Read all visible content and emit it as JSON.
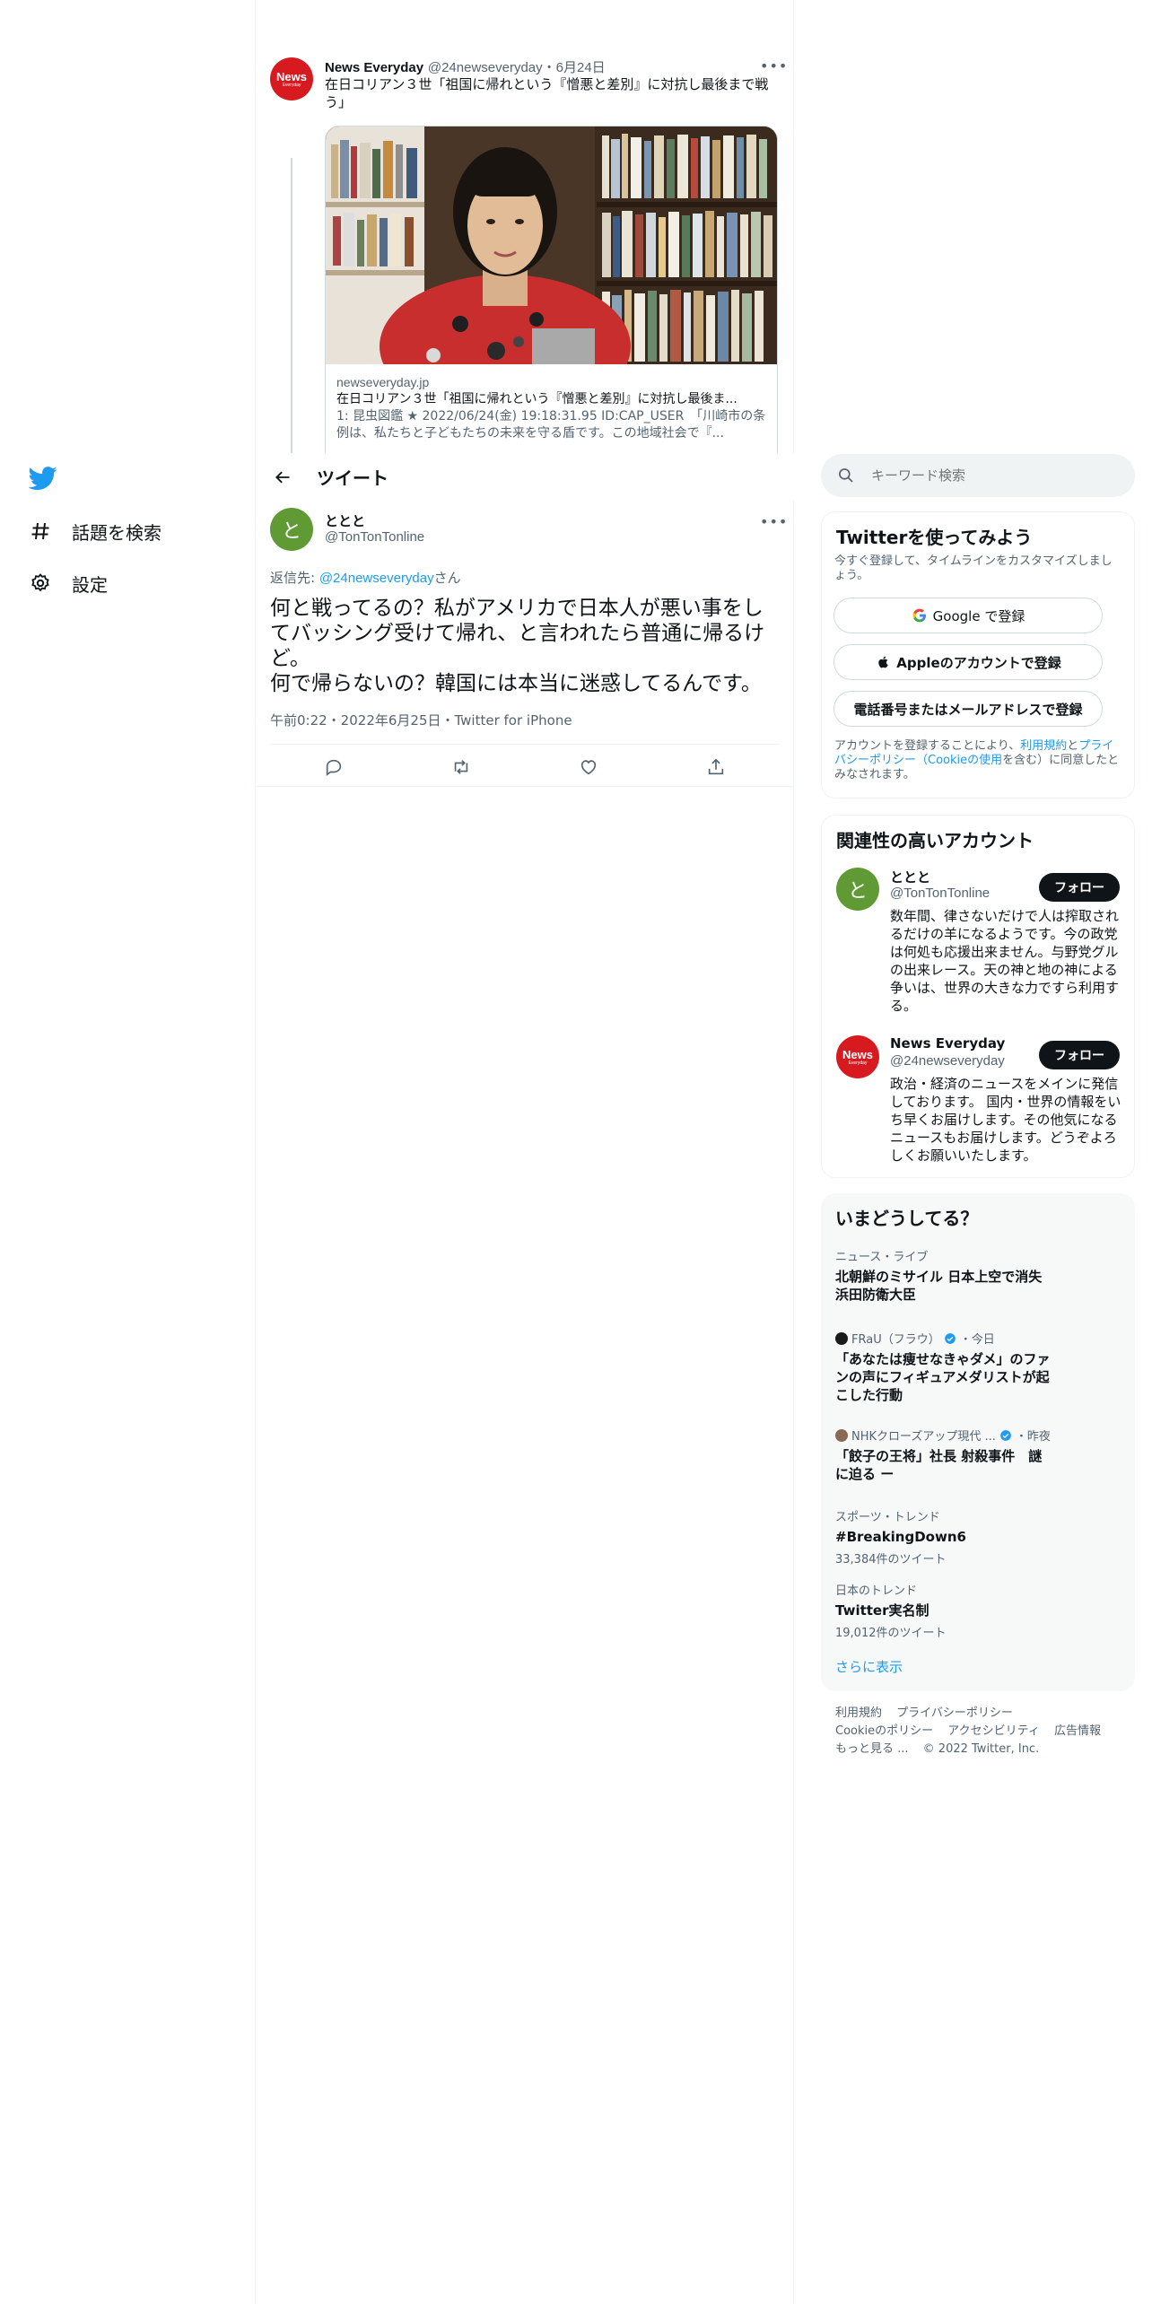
{
  "nav": {
    "explore_label": "話題を検索",
    "settings_label": "設定"
  },
  "parent_tweet": {
    "avatar_text_main": "News",
    "avatar_text_sub": "Everyday",
    "name": "News Everyday",
    "handle": "@24newseveryday",
    "date": "・6月24日",
    "text": "在日コリアン３世「祖国に帰れという『憎悪と差別』に対抗し最後まで戦う」",
    "card": {
      "domain": "newseveryday.jp",
      "title": "在日コリアン３世「祖国に帰れという『憎悪と差別』に対抗し最後ま...",
      "description": "1: 昆虫図鑑 ★ 2022/06/24(金) 19:18:31.95 ID:CAP_USER　「川崎市の条例は、私たちと子どもたちの未来を守る盾です。この地域社会で『..."
    }
  },
  "header": {
    "title": "ツイート"
  },
  "tweet": {
    "avatar_letter": "と",
    "name": "ととと",
    "handle": "@TonTonTonline",
    "reply_prefix": "返信先: ",
    "reply_mention": "@24newseveryday",
    "reply_suffix": "さん",
    "text": "何と戦ってるの？私がアメリカで日本人が悪い事をしてバッシング受けて帰れ、と言われたら普通に帰るけど。\n何で帰らないの？韓国には本当に迷惑してるんです。",
    "meta": "午前0:22・2022年6月25日・Twitter for iPhone"
  },
  "search": {
    "placeholder": "キーワード検索"
  },
  "signup": {
    "title": "Twitterを使ってみよう",
    "subtitle": "今すぐ登録して、タイムラインをカスタマイズしましょう。",
    "google_label": "Google で登録",
    "apple_label": "Appleのアカウントで登録",
    "phone_label": "電話番号またはメールアドレスで登録",
    "terms_prefix": "アカウントを登録することにより、",
    "terms_link1": "利用規約",
    "terms_mid1": "と",
    "terms_link2": "プライバシーポリシー（Cookieの使用",
    "terms_suffix": "を含む）に同意したとみなされます。"
  },
  "relevant": {
    "title": "関連性の高いアカウント",
    "accounts": [
      {
        "avatar_letter": "と",
        "name": "ととと",
        "handle": "@TonTonTonline",
        "follow_label": "フォロー",
        "bio": "数年間、律さないだけで人は搾取されるだけの羊になるようです。今の政党は何処も応援出来ません。与野党グルの出来レース。天の神と地の神による争いは、世界の大きな力ですら利用する。"
      },
      {
        "avatar_text_main": "News",
        "avatar_text_sub": "Everyday",
        "name": "News Everyday",
        "handle": "@24newseveryday",
        "follow_label": "フォロー",
        "bio": "政治・経済のニュースをメインに発信しております。 国内・世界の情報をいち早くお届けします。その他気になるニュースもお届けします。どうぞよろしくお願いいたします。"
      }
    ]
  },
  "trends": {
    "title": "いまどうしてる？",
    "items": [
      {
        "meta": "ニュース・ライブ",
        "title": "北朝鮮のミサイル 日本上空で消失　浜田防衛大臣"
      },
      {
        "source": "FRaU（フラウ）",
        "time": "・今日",
        "title": "「あなたは痩せなきゃダメ」のファンの声にフィギュアメダリストが起こした行動"
      },
      {
        "source": "NHKクローズアップ現代 ...",
        "time": "・昨夜",
        "title": "「餃子の王将」社長 射殺事件　謎に迫る ー"
      },
      {
        "meta": "スポーツ・トレンド",
        "title": "#BreakingDown6",
        "count": "33,384件のツイート"
      },
      {
        "meta": "日本のトレンド",
        "title": "Twitter実名制",
        "count": "19,012件のツイート"
      }
    ],
    "show_more": "さらに表示"
  },
  "footer": {
    "links": [
      "利用規約",
      "プライバシーポリシー",
      "Cookieのポリシー",
      "アクセシビリティ",
      "広告情報",
      "もっと見る ..."
    ],
    "copyright": "© 2022 Twitter, Inc."
  },
  "colors": {
    "accent": "#1d9bf0",
    "text": "#0f1419",
    "secondary": "#536471",
    "news_red": "#d71920",
    "avatar_green": "#5f9a35"
  }
}
